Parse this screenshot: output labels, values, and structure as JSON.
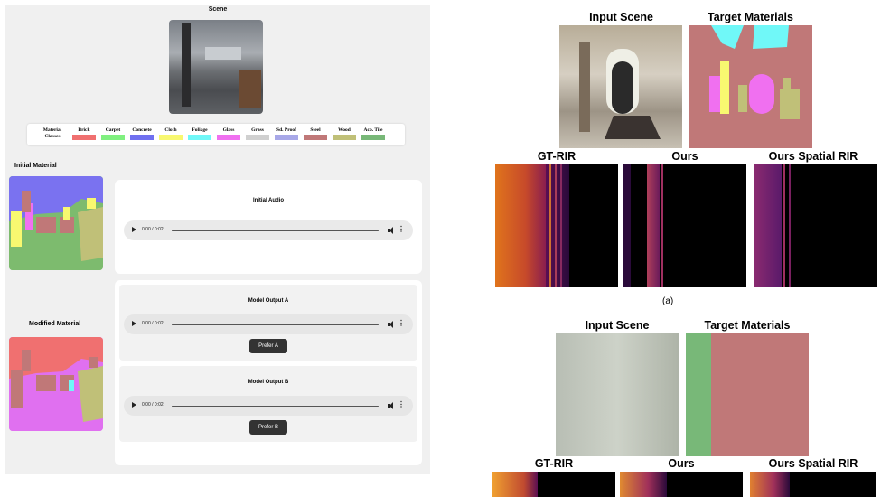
{
  "scene_title": "Scene",
  "legend": {
    "header": [
      "Material",
      "Classes"
    ],
    "items": [
      {
        "label": "Brick",
        "color": "#f07070"
      },
      {
        "label": "Carpet",
        "color": "#80f080"
      },
      {
        "label": "Concrete",
        "color": "#7070f0"
      },
      {
        "label": "Cloth",
        "color": "#f8f870"
      },
      {
        "label": "Foliage",
        "color": "#70f8f8"
      },
      {
        "label": "Glass",
        "color": "#f070f0"
      },
      {
        "label": "Grass",
        "color": "#d0d0d0"
      },
      {
        "label": "Sd. Proof",
        "color": "#a8a8e8"
      },
      {
        "label": "Steel",
        "color": "#c07878"
      },
      {
        "label": "Wood",
        "color": "#c0c078"
      },
      {
        "label": "Aco. Tile",
        "color": "#78b878"
      }
    ]
  },
  "initial_material_title": "Initial Material",
  "modified_material_title": "Modified Material",
  "initial_audio": {
    "title": "Initial Audio",
    "time": "0:00 / 0:02"
  },
  "output_a": {
    "title": "Model Output A",
    "time": "0:00 / 0:02",
    "button": "Prefer A"
  },
  "output_b": {
    "title": "Model Output B",
    "time": "0:00 / 0:02",
    "button": "Prefer B"
  },
  "figure_a": {
    "input_scene": "Input Scene",
    "target_materials": "Target Materials",
    "gt_rir": "GT-RIR",
    "ours": "Ours",
    "ours_spatial": "Ours Spatial RIR",
    "caption": "(a)"
  },
  "figure_b": {
    "input_scene": "Input Scene",
    "target_materials": "Target Materials",
    "gt_rir": "GT-RIR",
    "ours": "Ours",
    "ours_spatial": "Ours Spatial RIR"
  }
}
